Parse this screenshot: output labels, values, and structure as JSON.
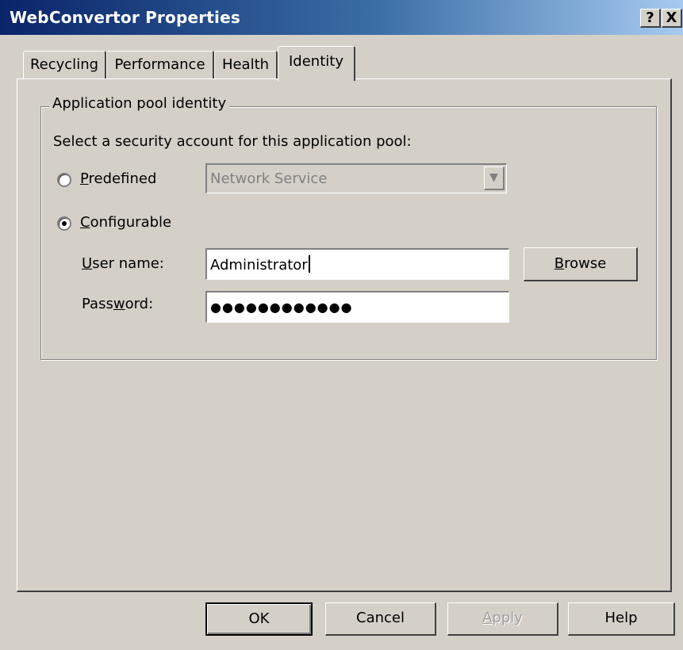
{
  "window": {
    "title": "WebConvertor Properties",
    "help_glyph": "?",
    "close_glyph": "X"
  },
  "tabs": [
    {
      "label": "Recycling",
      "active": false
    },
    {
      "label": "Performance",
      "active": false
    },
    {
      "label": "Health",
      "active": false
    },
    {
      "label": "Identity",
      "active": true
    }
  ],
  "identity": {
    "group_title": "Application pool identity",
    "instruction": "Select a security account for this application pool:",
    "predefined": {
      "mnemonic": "P",
      "label_rest": "redefined",
      "selected": false,
      "dropdown_value": "Network Service",
      "enabled": false
    },
    "configurable": {
      "mnemonic": "C",
      "label_rest": "onfigurable",
      "selected": true
    },
    "username": {
      "mnemonic": "U",
      "label_rest": "ser name:",
      "value": "Administrator"
    },
    "password": {
      "label_before": "Pass",
      "mnemonic": "w",
      "label_after": "ord:",
      "masked_value": "●●●●●●●●●●●●"
    },
    "browse": {
      "mnemonic": "B",
      "label_rest": "rowse"
    }
  },
  "footer": {
    "ok": "OK",
    "cancel": "Cancel",
    "apply": {
      "mnemonic": "A",
      "label_rest": "pply",
      "enabled": false
    },
    "help": "Help"
  }
}
